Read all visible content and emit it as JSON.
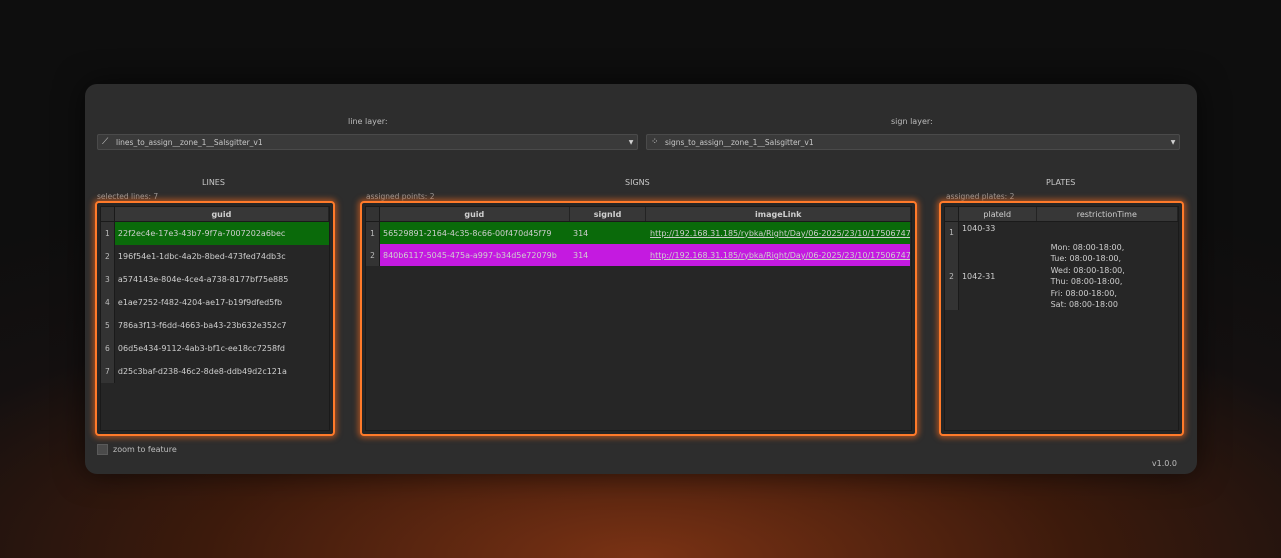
{
  "layers": {
    "line_label": "line layer:",
    "line_value": "lines_to_assign__zone_1__Salsgitter_v1",
    "sign_label": "sign layer:",
    "sign_value": "signs_to_assign__zone_1__Salsgitter_v1"
  },
  "lines": {
    "title": "LINES",
    "count": "selected lines: 7",
    "header": "guid",
    "rows": [
      {
        "n": "1",
        "guid": "22f2ec4e-17e3-43b7-9f7a-7007202a6bec"
      },
      {
        "n": "2",
        "guid": "196f54e1-1dbc-4a2b-8bed-473fed74db3c"
      },
      {
        "n": "3",
        "guid": "a574143e-804e-4ce4-a738-8177bf75e885"
      },
      {
        "n": "4",
        "guid": "e1ae7252-f482-4204-ae17-b19f9dfed5fb"
      },
      {
        "n": "5",
        "guid": "786a3f13-f6dd-4663-ba43-23b632e352c7"
      },
      {
        "n": "6",
        "guid": "06d5e434-9112-4ab3-bf1c-ee18cc7258fd"
      },
      {
        "n": "7",
        "guid": "d25c3baf-d238-46c2-8de8-ddb49d2c121a"
      }
    ]
  },
  "signs": {
    "title": "SIGNS",
    "count": "assigned points: 2",
    "headers": {
      "guid": "guid",
      "signId": "signId",
      "imageLink": "imageLink"
    },
    "rows": [
      {
        "n": "1",
        "guid": "56529891-2164-4c35-8c66-00f470d45f79",
        "signId": "314",
        "imageLink": "http://192.168.31.185/rybka/Right/Day/06-2025/23/10/17506747860"
      },
      {
        "n": "2",
        "guid": "840b6117-5045-475a-a997-b34d5e72079b",
        "signId": "314",
        "imageLink": "http://192.168.31.185/rybka/Right/Day/06-2025/23/10/17506747820"
      }
    ]
  },
  "plates": {
    "title": "PLATES",
    "count": "assigned plates: 2",
    "headers": {
      "plateId": "plateId",
      "restrictionTime": "restrictionTime"
    },
    "rows": [
      {
        "n": "1",
        "plateId": "1040-33",
        "restriction": ""
      },
      {
        "n": "2",
        "plateId": "1042-31",
        "restriction": [
          "Mon: 08:00-18:00,",
          "Tue: 08:00-18:00,",
          "Wed: 08:00-18:00,",
          "Thu: 08:00-18:00,",
          "Fri: 08:00-18:00,",
          "Sat: 08:00-18:00"
        ]
      }
    ]
  },
  "footer": {
    "zoom_label": "zoom to feature",
    "version": "v1.0.0"
  },
  "colors": {
    "highlight_green": "#0a6a0a",
    "highlight_magenta": "#c41ae0",
    "panel_glow": "#ff7a2a"
  }
}
